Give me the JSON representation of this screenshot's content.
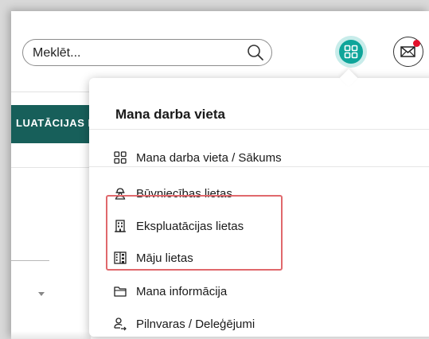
{
  "search": {
    "placeholder": "Meklēt..."
  },
  "header": {
    "apps_icon": "apps-grid-icon",
    "mail_icon": "mail-notification-icon",
    "notification_color": "#e2112b"
  },
  "nav": {
    "tab_label": "LUATĀCIJAS L"
  },
  "dropdown": {
    "title": "Mana darba vieta",
    "items": [
      {
        "label": "Mana darba vieta / Sākums",
        "icon": "grid-icon"
      },
      {
        "label": "Būvniecības lietas",
        "icon": "builder-icon"
      },
      {
        "label": "Ekspluatācijas lietas",
        "icon": "building-icon"
      },
      {
        "label": "Māju lietas",
        "icon": "house-building-icon"
      },
      {
        "label": "Mana informācija",
        "icon": "folder-icon"
      },
      {
        "label": "Pilnvaras / Deleģējumi",
        "icon": "user-delegate-icon"
      }
    ],
    "highlight_color": "#e0686c"
  },
  "colors": {
    "accent": "#0ea59a",
    "nav": "#175f5a"
  }
}
